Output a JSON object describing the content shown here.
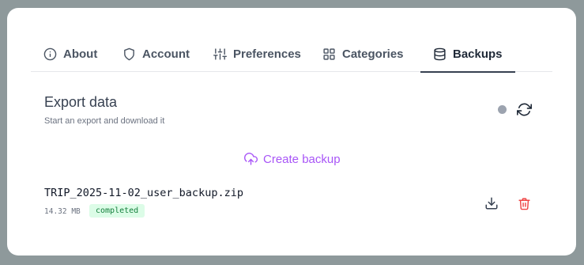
{
  "tabs": [
    {
      "label": "About",
      "icon": "info-circle-icon",
      "active": false
    },
    {
      "label": "Account",
      "icon": "shield-icon",
      "active": false
    },
    {
      "label": "Preferences",
      "icon": "sliders-icon",
      "active": false
    },
    {
      "label": "Categories",
      "icon": "grid-icon",
      "active": false
    },
    {
      "label": "Backups",
      "icon": "database-icon",
      "active": true
    }
  ],
  "export": {
    "title": "Export data",
    "subtitle": "Start an export and download it",
    "status_color": "#9ca3af",
    "create_label": "Create backup"
  },
  "backups": [
    {
      "filename": "TRIP_2025-11-02_user_backup.zip",
      "size": "14.32 MB",
      "status": "completed"
    }
  ],
  "colors": {
    "accent": "#a855f7",
    "danger": "#ef4444",
    "success_bg": "#dcfce7",
    "success_text": "#15803d"
  }
}
